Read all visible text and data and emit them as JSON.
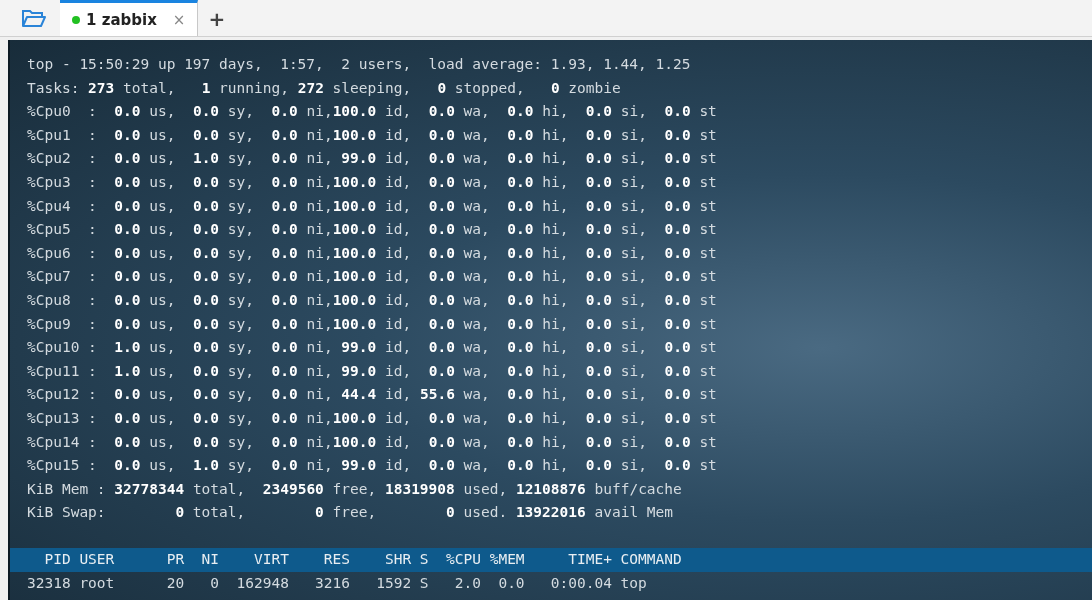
{
  "tabs": [
    {
      "label": "1 zabbix",
      "selected": true,
      "connected": true,
      "close": "×"
    }
  ],
  "new_tab": "+",
  "terminal": {
    "lines": [
      "top - 15:50:29 up 197 days,  1:57,  2 users,  load average: 1.93, 1.44, 1.25",
      "Tasks: **273** total,   **1** running, **272** sleeping,   **0** stopped,   **0** zombie",
      "%Cpu0  :  **0.0** us,  **0.0** sy,  **0.0** ni,**100.0** id,  **0.0** wa,  **0.0** hi,  **0.0** si,  **0.0** st",
      "%Cpu1  :  **0.0** us,  **0.0** sy,  **0.0** ni,**100.0** id,  **0.0** wa,  **0.0** hi,  **0.0** si,  **0.0** st",
      "%Cpu2  :  **0.0** us,  **1.0** sy,  **0.0** ni, **99.0** id,  **0.0** wa,  **0.0** hi,  **0.0** si,  **0.0** st",
      "%Cpu3  :  **0.0** us,  **0.0** sy,  **0.0** ni,**100.0** id,  **0.0** wa,  **0.0** hi,  **0.0** si,  **0.0** st",
      "%Cpu4  :  **0.0** us,  **0.0** sy,  **0.0** ni,**100.0** id,  **0.0** wa,  **0.0** hi,  **0.0** si,  **0.0** st",
      "%Cpu5  :  **0.0** us,  **0.0** sy,  **0.0** ni,**100.0** id,  **0.0** wa,  **0.0** hi,  **0.0** si,  **0.0** st",
      "%Cpu6  :  **0.0** us,  **0.0** sy,  **0.0** ni,**100.0** id,  **0.0** wa,  **0.0** hi,  **0.0** si,  **0.0** st",
      "%Cpu7  :  **0.0** us,  **0.0** sy,  **0.0** ni,**100.0** id,  **0.0** wa,  **0.0** hi,  **0.0** si,  **0.0** st",
      "%Cpu8  :  **0.0** us,  **0.0** sy,  **0.0** ni,**100.0** id,  **0.0** wa,  **0.0** hi,  **0.0** si,  **0.0** st",
      "%Cpu9  :  **0.0** us,  **0.0** sy,  **0.0** ni,**100.0** id,  **0.0** wa,  **0.0** hi,  **0.0** si,  **0.0** st",
      "%Cpu10 :  **1.0** us,  **0.0** sy,  **0.0** ni, **99.0** id,  **0.0** wa,  **0.0** hi,  **0.0** si,  **0.0** st",
      "%Cpu11 :  **1.0** us,  **0.0** sy,  **0.0** ni, **99.0** id,  **0.0** wa,  **0.0** hi,  **0.0** si,  **0.0** st",
      "%Cpu12 :  **0.0** us,  **0.0** sy,  **0.0** ni, **44.4** id, **55.6** wa,  **0.0** hi,  **0.0** si,  **0.0** st",
      "%Cpu13 :  **0.0** us,  **0.0** sy,  **0.0** ni,**100.0** id,  **0.0** wa,  **0.0** hi,  **0.0** si,  **0.0** st",
      "%Cpu14 :  **0.0** us,  **0.0** sy,  **0.0** ni,**100.0** id,  **0.0** wa,  **0.0** hi,  **0.0** si,  **0.0** st",
      "%Cpu15 :  **0.0** us,  **1.0** sy,  **0.0** ni, **99.0** id,  **0.0** wa,  **0.0** hi,  **0.0** si,  **0.0** st",
      "KiB Mem : **32778344** total,  **2349560** free, **18319908** used, **12108876** buff/cache",
      "KiB Swap:        **0** total,        **0** free,        **0** used. **13922016** avail Mem"
    ],
    "process_header": "  PID USER      PR  NI    VIRT    RES    SHR S  %CPU %MEM     TIME+ COMMAND",
    "processes": [
      "32318 root      20   0  162948   3216   1592 S   2.0  0.0   0:00.04 top"
    ]
  }
}
